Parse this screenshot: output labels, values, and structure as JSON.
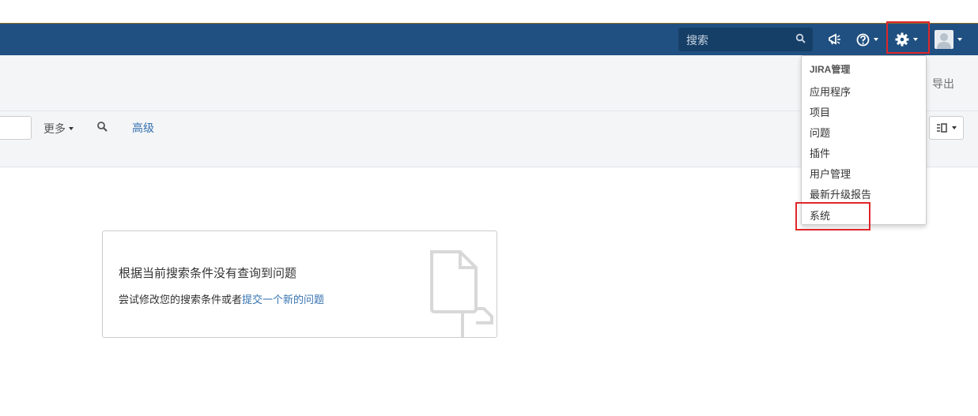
{
  "header": {
    "search_placeholder": "搜索",
    "icons": [
      "search-icon",
      "megaphone-icon",
      "help-icon",
      "gear-icon",
      "avatar-icon"
    ],
    "colors": {
      "bar": "#205081",
      "highlight_box": "#e0262a"
    }
  },
  "subheader": {
    "export_label": "导出"
  },
  "filterbar": {
    "more_label": "更多",
    "advanced_label": "高级"
  },
  "empty_state": {
    "title": "根据当前搜索条件没有查询到问题",
    "description": "尝试修改您的搜索条件或者",
    "link": "提交一个新的问题"
  },
  "admin_menu": {
    "heading": "JIRA管理",
    "items": [
      "应用程序",
      "项目",
      "问题",
      "插件",
      "用户管理",
      "最新升级报告",
      "系统"
    ]
  }
}
